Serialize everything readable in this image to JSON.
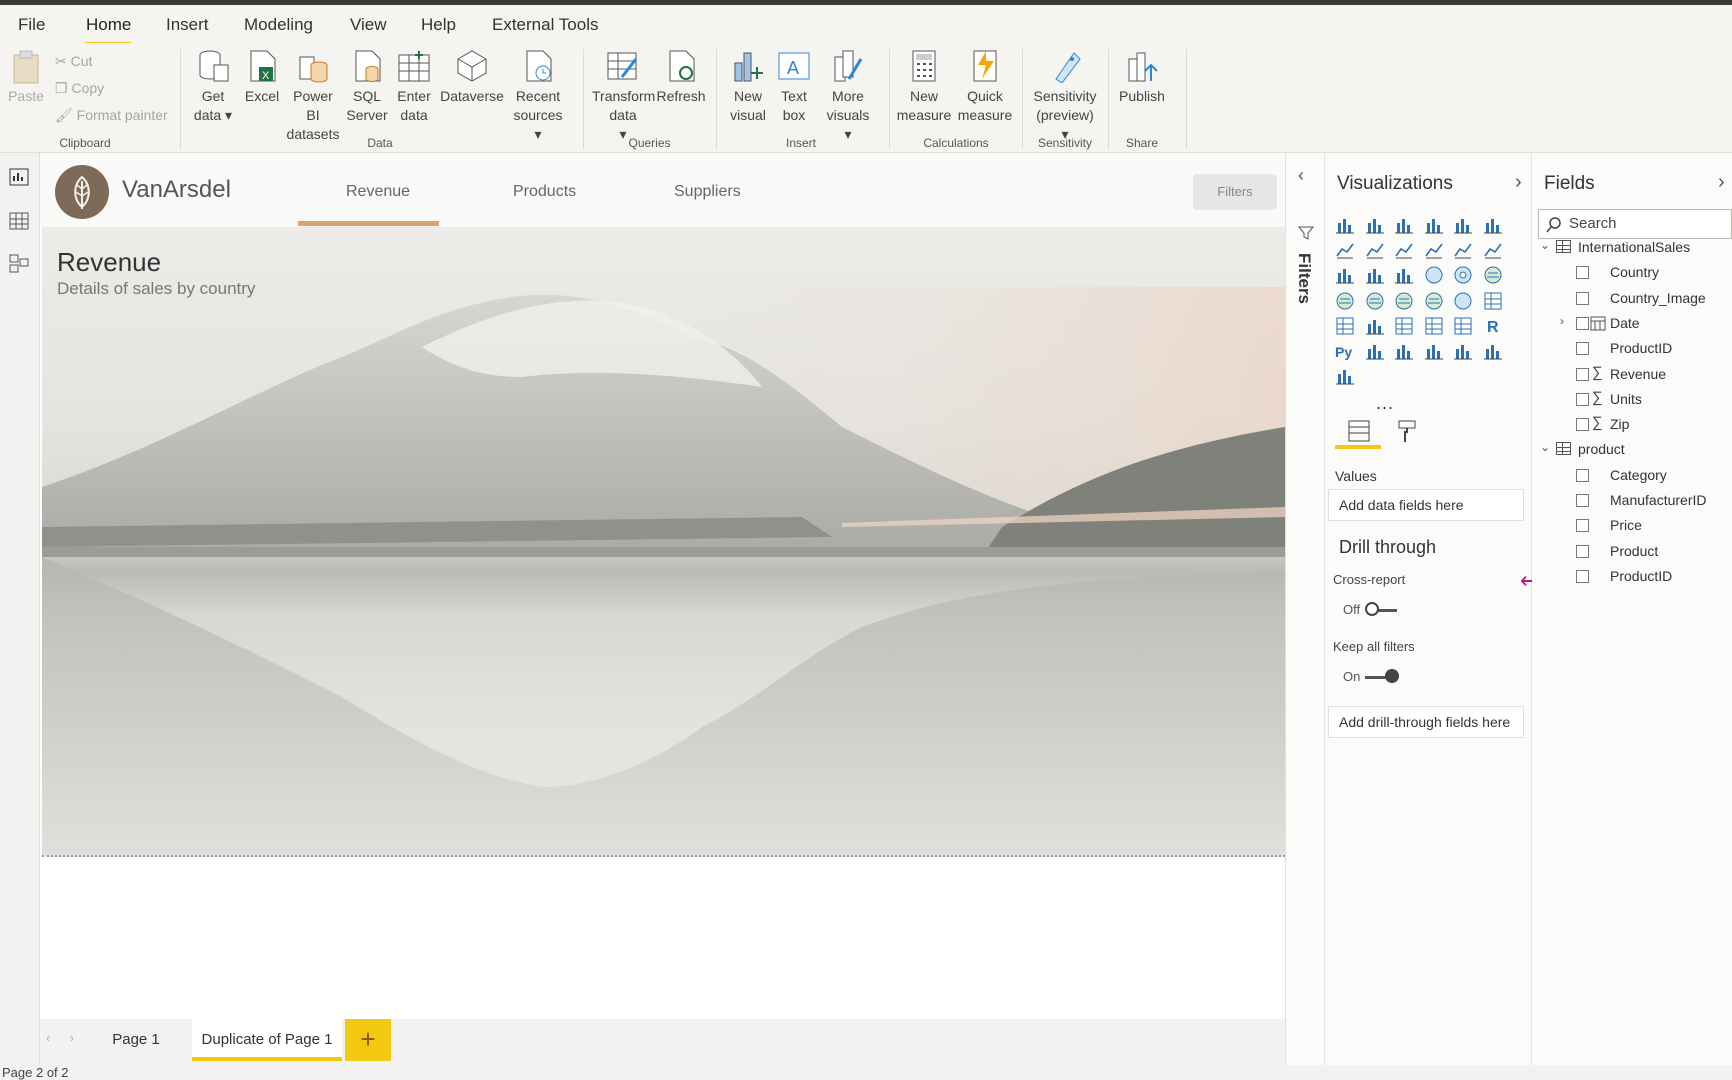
{
  "menu": {
    "items": [
      "File",
      "Home",
      "Insert",
      "Modeling",
      "View",
      "Help",
      "External Tools"
    ]
  },
  "ribbon": {
    "clipboard": {
      "paste": "Paste",
      "cut": "Cut",
      "copy": "Copy",
      "format_painter": "Format painter",
      "group": "Clipboard"
    },
    "data": {
      "get_data": "Get data",
      "excel": "Excel",
      "pbi_datasets": "Power BI datasets",
      "sql": "SQL Server",
      "enter_data": "Enter data",
      "dataverse": "Dataverse",
      "recent": "Recent sources",
      "group": "Data"
    },
    "queries": {
      "transform": "Transform data",
      "refresh": "Refresh",
      "group": "Queries"
    },
    "insert": {
      "new_visual": "New visual",
      "text_box": "Text box",
      "more_visuals": "More visuals",
      "group": "Insert"
    },
    "calculations": {
      "new_measure": "New measure",
      "quick_measure": "Quick measure",
      "group": "Calculations"
    },
    "sensitivity": {
      "sensitivity": "Sensitivity (preview)",
      "group": "Sensitivity"
    },
    "share": {
      "publish": "Publish",
      "group": "Share"
    }
  },
  "report": {
    "brand": "VanArsdel",
    "tabs": [
      "Revenue",
      "Products",
      "Suppliers"
    ],
    "filters_button": "Filters",
    "title": "Revenue",
    "subtitle": "Details of sales by country"
  },
  "pages": {
    "items": [
      "Page 1",
      "Duplicate of Page 1"
    ],
    "add": "+",
    "status": "Page 2 of 2"
  },
  "filters_pane": {
    "label": "Filters"
  },
  "visualizations": {
    "title": "Visualizations",
    "values_label": "Values",
    "values_placeholder": "Add data fields here",
    "drill_title": "Drill through",
    "cross_report": "Cross-report",
    "cross_state": "Off",
    "keep_filters": "Keep all filters",
    "keep_state": "On",
    "drill_placeholder": "Add drill-through fields here",
    "more": "..."
  },
  "fields": {
    "title": "Fields",
    "search_placeholder": "Search",
    "tables": [
      {
        "name": "InternationalSales",
        "fields": [
          "Country",
          "Country_Image",
          "Date",
          "ProductID",
          "Revenue",
          "Units",
          "Zip"
        ]
      },
      {
        "name": "product",
        "fields": [
          "Category",
          "ManufacturerID",
          "Price",
          "Product",
          "ProductID"
        ]
      }
    ]
  },
  "colors": {
    "accent": "#f2c811",
    "tab_underline": "#d9a46d",
    "resize_arrow": "#c0168a"
  }
}
